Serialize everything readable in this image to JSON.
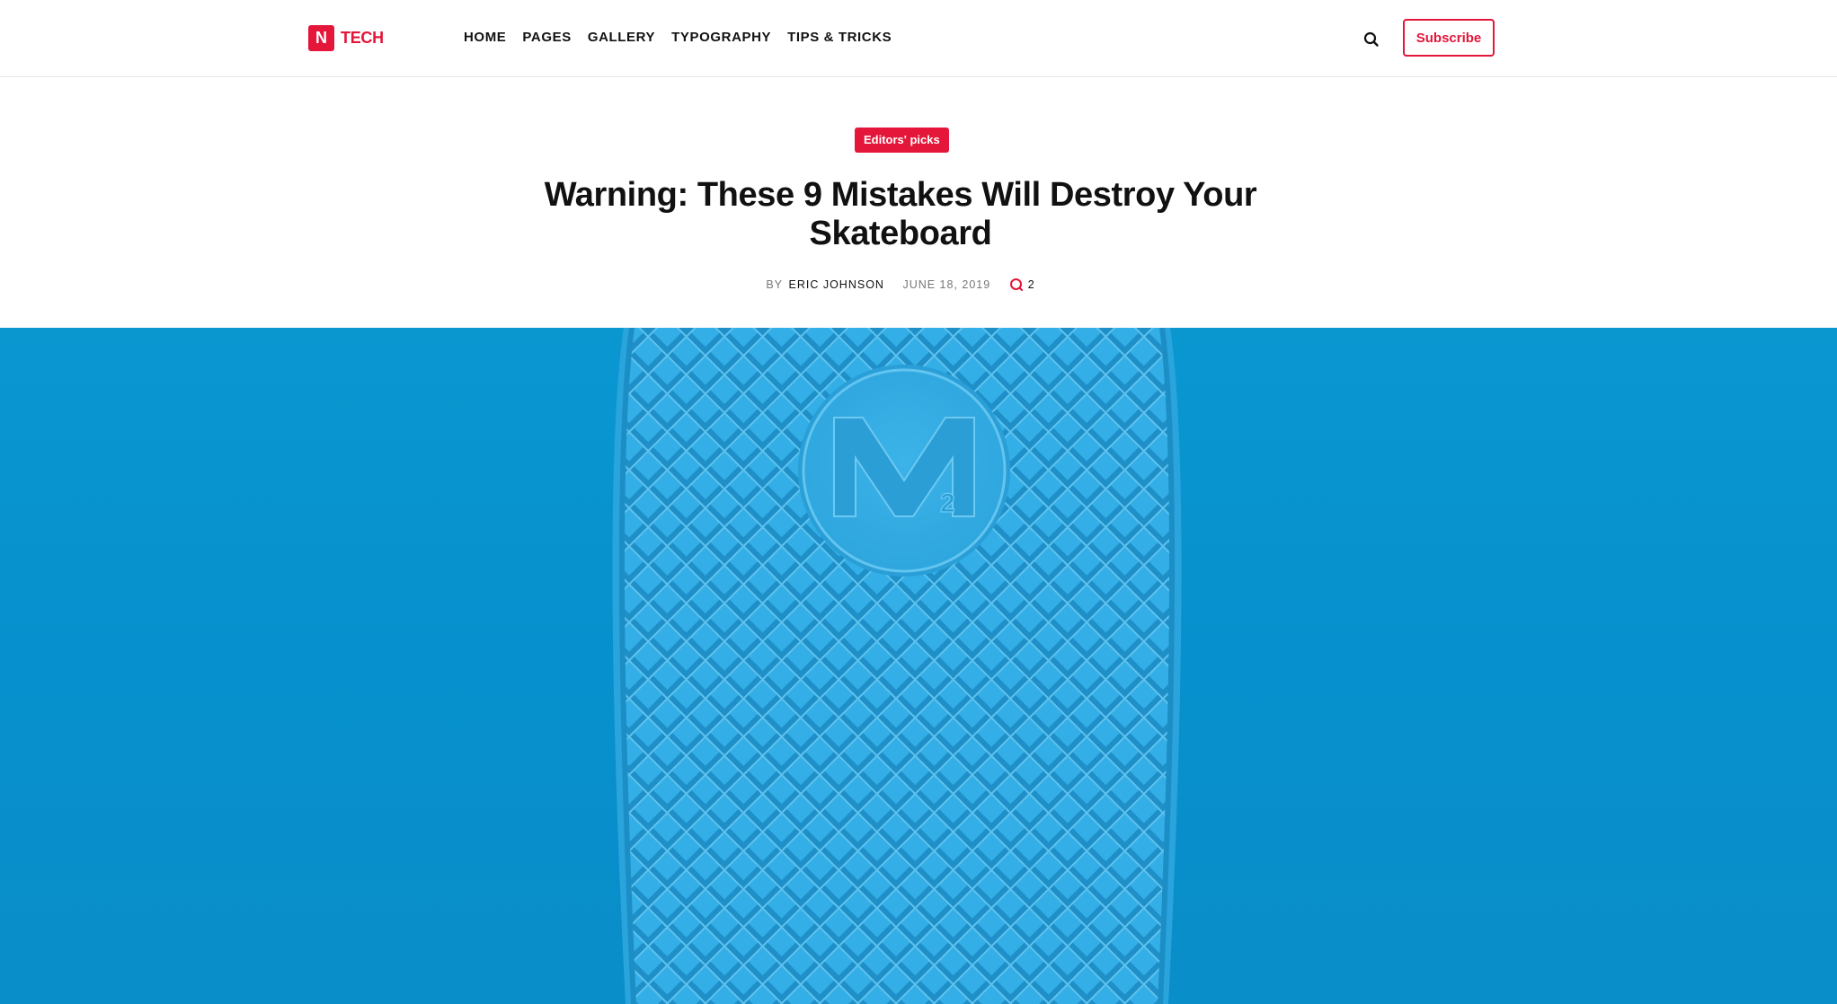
{
  "header": {
    "logo": {
      "mark": "N",
      "text": "TECH"
    },
    "nav": [
      "HOME",
      "PAGES",
      "GALLERY",
      "TYPOGRAPHY",
      "TIPS & TRICKS"
    ],
    "subscribe_label": "Subscribe"
  },
  "article": {
    "category": "Editors' picks",
    "title": "Warning: These 9 Mistakes Will Destroy Your Skateboard",
    "meta": {
      "by_label": "BY",
      "author": "ERIC JOHNSON",
      "date": "JUNE 18, 2019",
      "comment_count": "2"
    }
  },
  "colors": {
    "accent": "#e4163a",
    "hero_background": "#0690cd",
    "deck": "#33aee6"
  },
  "icons": {
    "search": "search-icon",
    "comments": "comment-icon"
  }
}
